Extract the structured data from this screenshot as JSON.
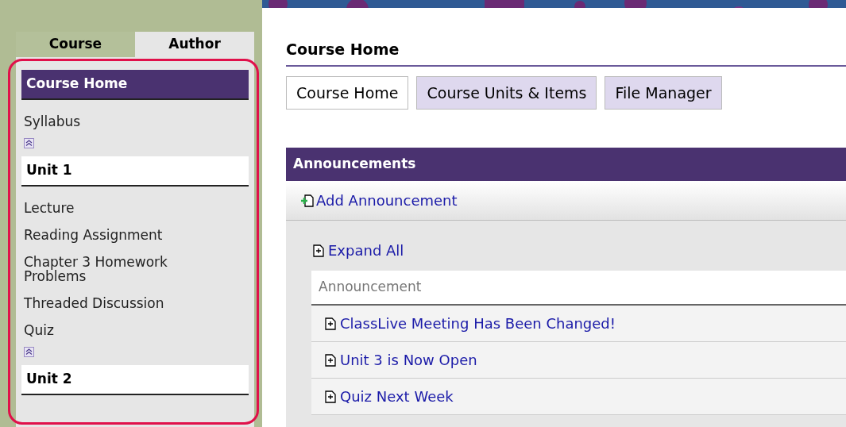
{
  "sidebar": {
    "tabs": [
      {
        "label": "Course",
        "selected": true
      },
      {
        "label": "Author",
        "selected": false
      }
    ],
    "sections": [
      {
        "title": "Course Home",
        "selected": true,
        "items": [
          "Syllabus"
        ],
        "collapse_icon": true
      },
      {
        "title": "Unit 1",
        "selected": false,
        "items": [
          "Lecture",
          "Reading Assignment",
          "Chapter 3 Homework Problems",
          "Threaded Discussion",
          "Quiz"
        ],
        "collapse_icon": true
      },
      {
        "title": "Unit 2",
        "selected": false,
        "collapse_icon": false
      }
    ]
  },
  "main": {
    "title": "Course Home",
    "tabs": [
      {
        "label": "Course Home",
        "selected": true
      },
      {
        "label": "Course Units & Items",
        "selected": false
      },
      {
        "label": "File Manager",
        "selected": false
      }
    ],
    "announcements": {
      "title": "Announcements",
      "add_link": "Add Announcement",
      "expand_link": "Expand All",
      "column": "Announcement",
      "rows": [
        "ClassLive Meeting Has Been Changed!",
        "Unit 3 is Now Open",
        "Quiz Next Week"
      ]
    }
  }
}
